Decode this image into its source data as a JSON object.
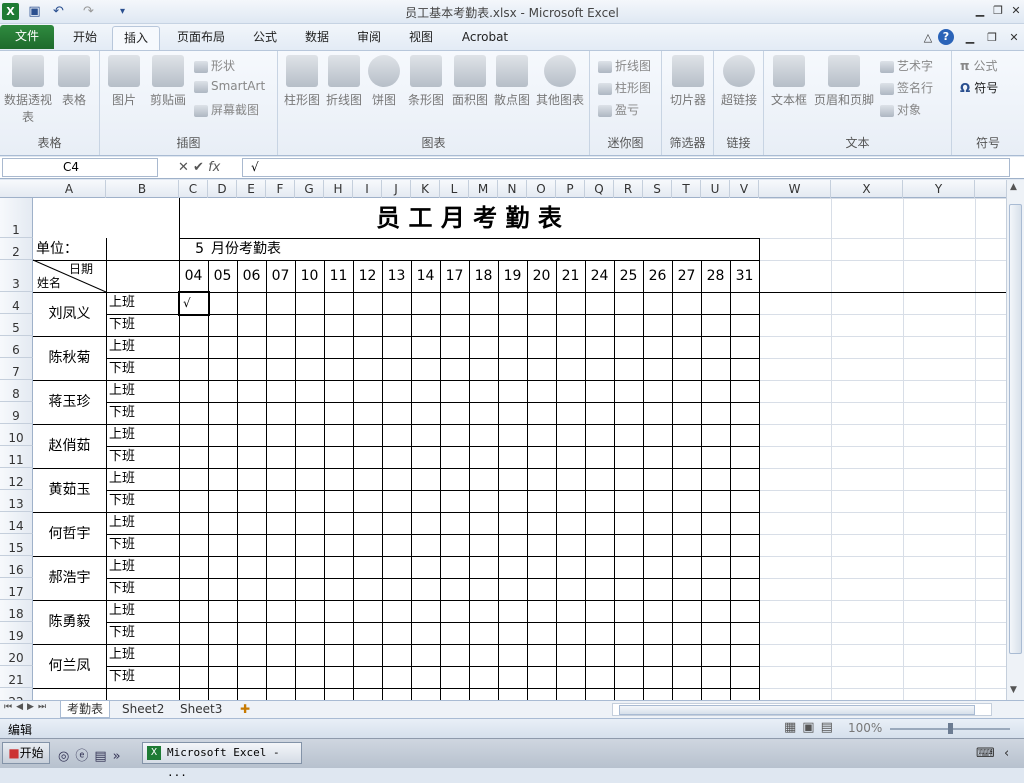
{
  "window": {
    "title": "员工基本考勤表.xlsx - Microsoft Excel"
  },
  "tabs": [
    "文件",
    "开始",
    "插入",
    "页面布局",
    "公式",
    "数据",
    "审阅",
    "视图",
    "Acrobat"
  ],
  "ribbon": {
    "groups": {
      "table": "表格",
      "illustrations": "插图",
      "charts": "图表",
      "sparklines": "迷你图",
      "filter": "筛选器",
      "links": "链接",
      "text": "文本",
      "symbols": "符号"
    },
    "table_btns": {
      "pivot": "数据透视表",
      "table": "表格"
    },
    "illus": {
      "picture": "图片",
      "clipart": "剪贴画",
      "shapes": "形状",
      "smartart": "SmartArt",
      "screenshot": "屏幕截图"
    },
    "charts": {
      "column": "柱形图",
      "line": "折线图",
      "pie": "饼图",
      "bar": "条形图",
      "area": "面积图",
      "scatter": "散点图",
      "other": "其他图表"
    },
    "spark": {
      "line": "折线图",
      "column": "柱形图",
      "winloss": "盈亏"
    },
    "slicer": "切片器",
    "hyperlink": "超链接",
    "text": {
      "textbox": "文本框",
      "header": "页眉和页脚",
      "wordart": "艺术字",
      "signature": "签名行",
      "object": "对象"
    },
    "symbols": {
      "equation": "公式",
      "symbol": "符号"
    }
  },
  "formula_bar": {
    "name_box": "C4",
    "fx": "fx",
    "content": "√"
  },
  "columns": [
    "A",
    "B",
    "C",
    "D",
    "E",
    "F",
    "G",
    "H",
    "I",
    "J",
    "K",
    "L",
    "M",
    "N",
    "O",
    "P",
    "Q",
    "R",
    "S",
    "T",
    "U",
    "V",
    "W",
    "X",
    "Y"
  ],
  "rows": [
    "1",
    "2",
    "3",
    "4",
    "5",
    "6",
    "7",
    "8",
    "9",
    "10",
    "11",
    "12",
    "13",
    "14",
    "15",
    "16",
    "17",
    "18",
    "19",
    "20",
    "21",
    "22"
  ],
  "sheet": {
    "title": "员 工 月 考 勤 表",
    "unit_label": "单位：",
    "month": "5",
    "month_label": "月份考勤表",
    "header_date": "日期",
    "header_name": "姓名",
    "days": [
      "04",
      "05",
      "06",
      "07",
      "10",
      "11",
      "12",
      "13",
      "14",
      "17",
      "18",
      "19",
      "20",
      "21",
      "24",
      "25",
      "26",
      "27",
      "28",
      "31"
    ],
    "shift_on": "上班",
    "shift_off": "下班",
    "employees": [
      "刘凤义",
      "陈秋菊",
      "蒋玉珍",
      "赵俏茹",
      "黄茹玉",
      "何哲宇",
      "郝浩宇",
      "陈勇毅",
      "何兰凤"
    ],
    "check_mark": "√"
  },
  "sheet_tabs": [
    "考勤表",
    "Sheet2",
    "Sheet3"
  ],
  "status": {
    "mode": "编辑",
    "zoom": "100%"
  },
  "taskbar": {
    "start": "开始",
    "app": "Microsoft Excel - ..."
  }
}
